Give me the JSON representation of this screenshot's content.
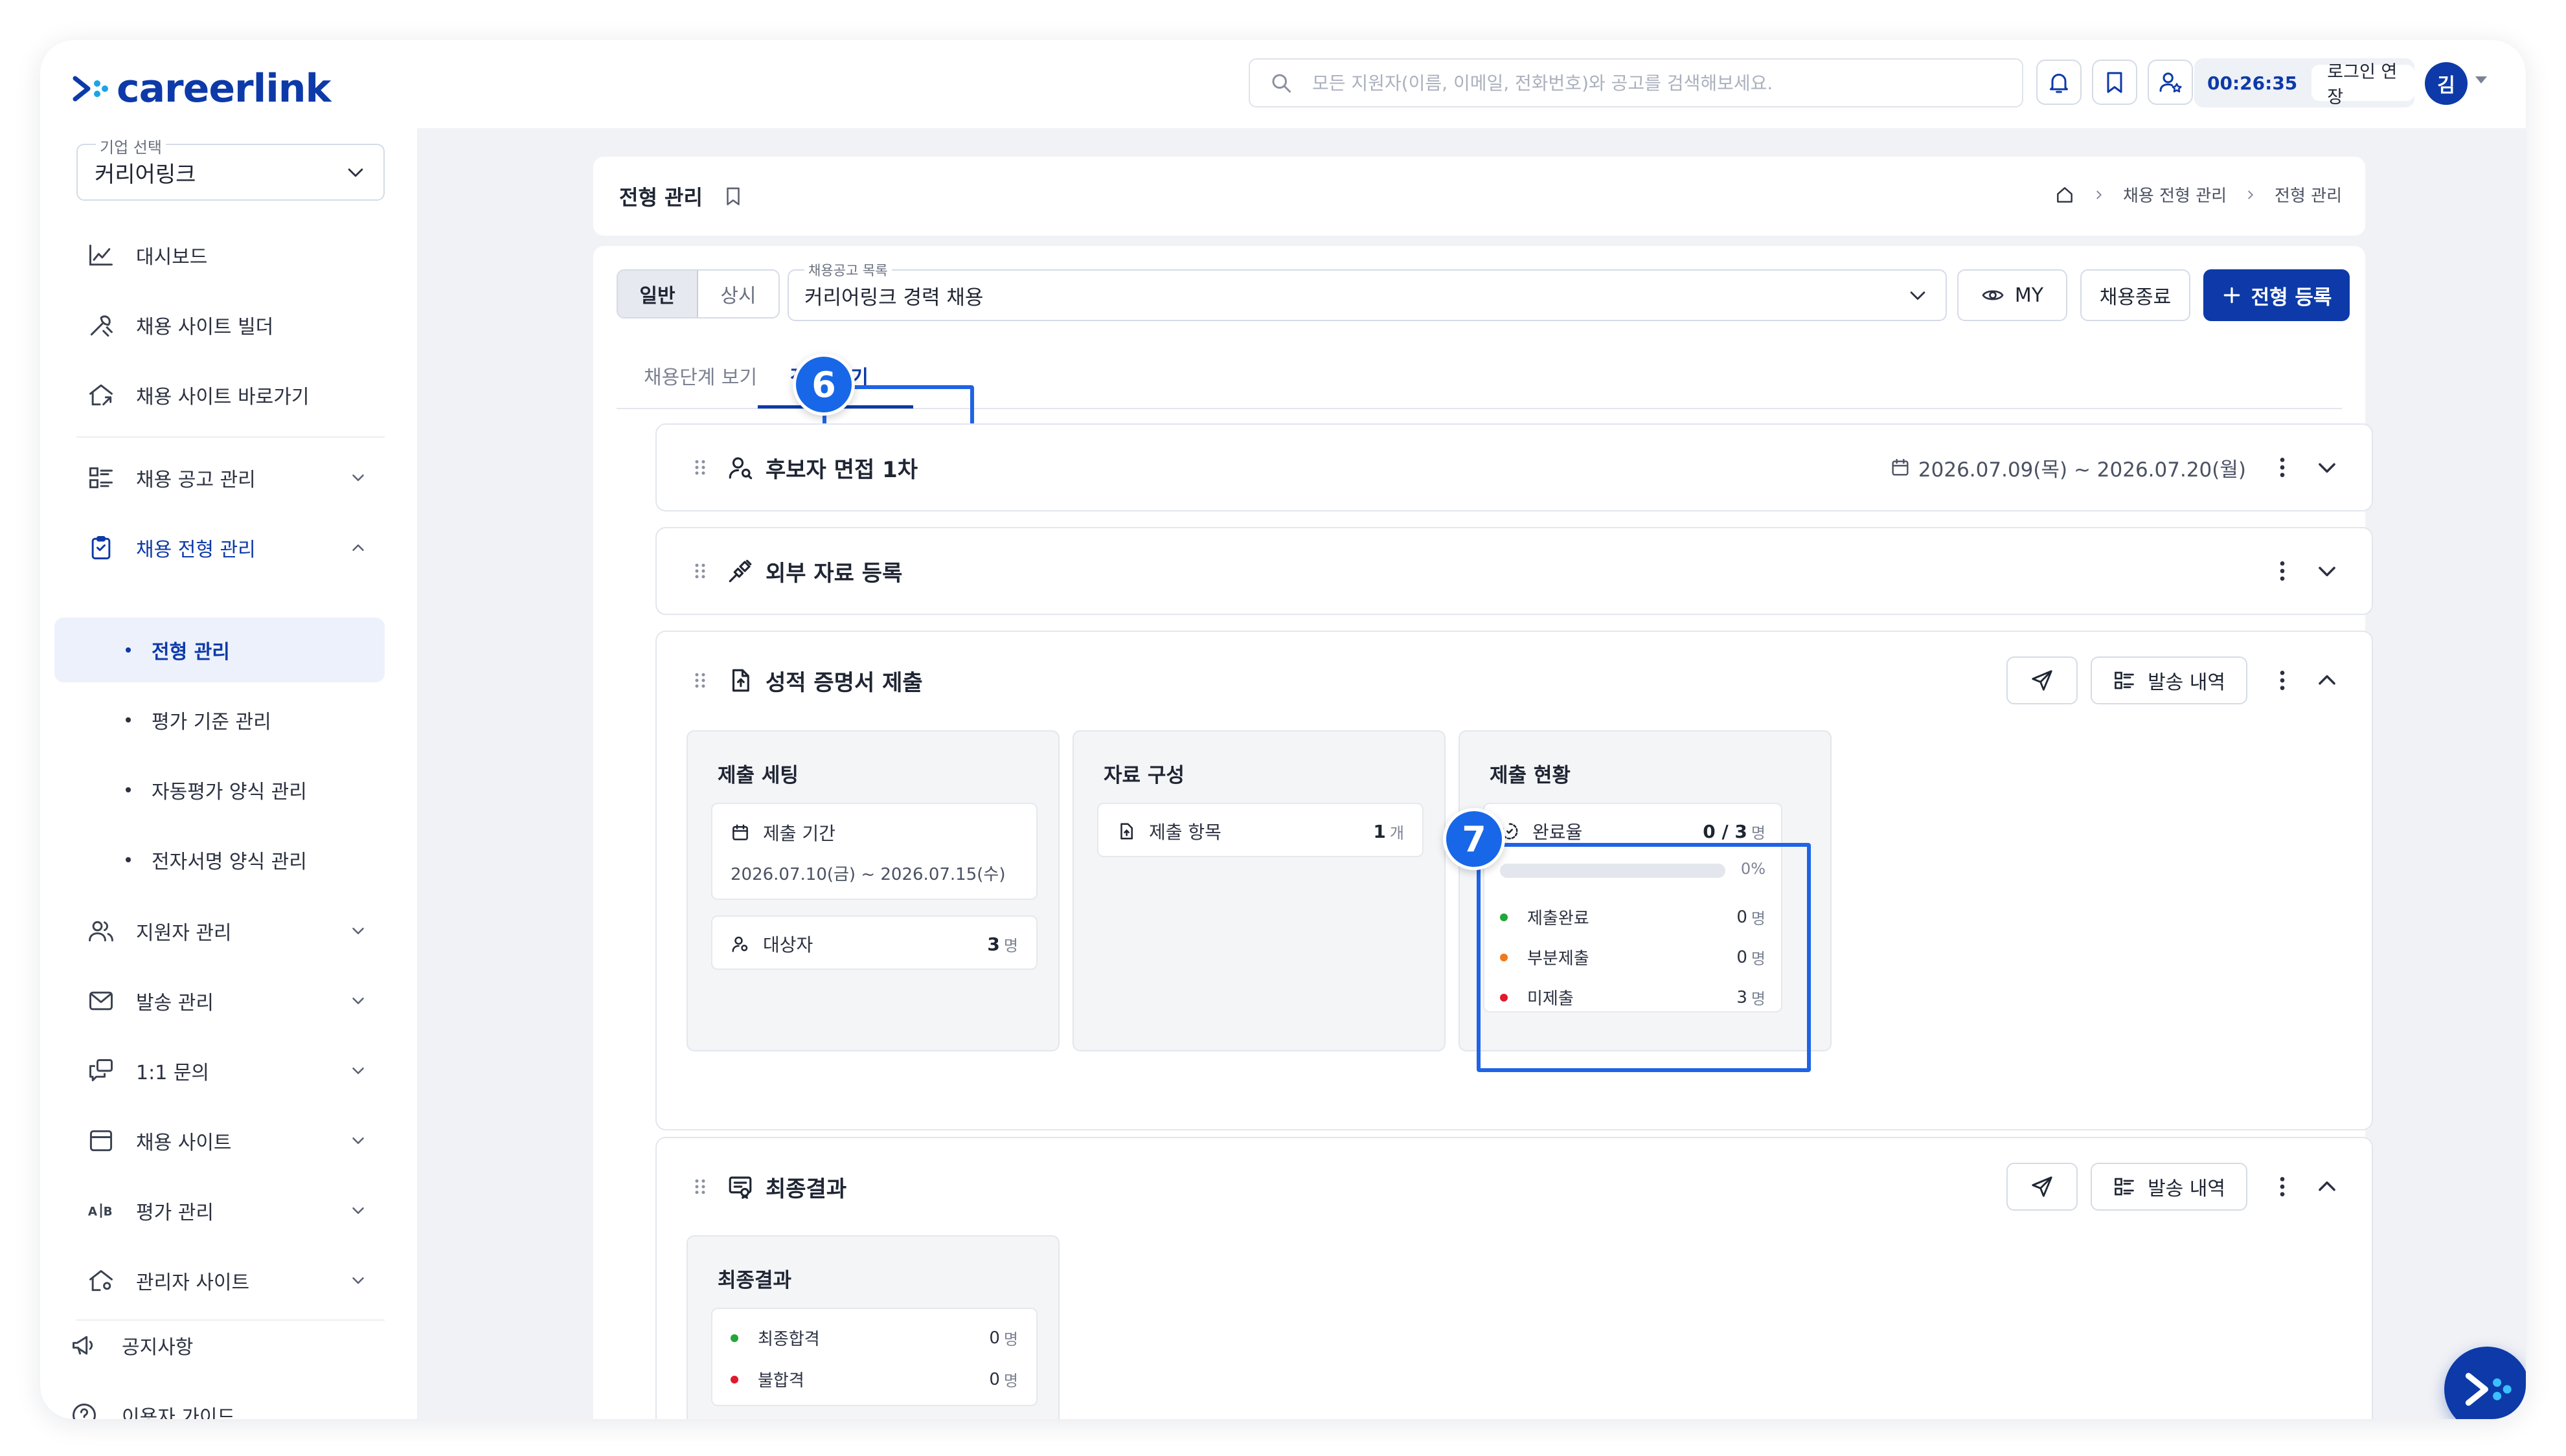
{
  "app": {
    "logo_text": "careerlink",
    "brand_color": "#0d3aa8",
    "highlight_color": "#1f63e6"
  },
  "topbar": {
    "search_placeholder": "모든 지원자(이름, 이메일, 전화번호)와 공고를 검색해보세요.",
    "icons": [
      "search-icon",
      "bell-icon",
      "bookmark-icon",
      "user-star-icon"
    ],
    "session_timer": "00:26:35",
    "extend_login_label": "로그인 연장",
    "avatar_initial": "김"
  },
  "sidebar": {
    "company_label": "기업 선택",
    "company_value": "커리어링크",
    "items": [
      {
        "label": "대시보드",
        "icon": "chart-icon"
      },
      {
        "label": "채용 사이트 빌더",
        "icon": "tools-icon"
      },
      {
        "label": "채용 사이트 바로가기",
        "icon": "home-link-icon"
      },
      {
        "label": "채용 공고 관리",
        "icon": "list-icon"
      },
      {
        "label": "채용 전형 관리",
        "icon": "clipboard-icon"
      },
      {
        "label": "지원자 관리",
        "icon": "users-icon"
      },
      {
        "label": "발송 관리",
        "icon": "mail-icon"
      },
      {
        "label": "1:1 문의",
        "icon": "chat-icon"
      },
      {
        "label": "채용 사이트",
        "icon": "window-icon"
      },
      {
        "label": "평가 관리",
        "icon": "ab-icon"
      },
      {
        "label": "관리자 사이트",
        "icon": "admin-home-icon"
      }
    ],
    "sub_items": [
      "전형 관리",
      "평가 기준 관리",
      "자동평가 양식 관리",
      "전자서명 양식 관리"
    ],
    "bottom_items": [
      {
        "label": "공지사항",
        "icon": "megaphone-icon"
      },
      {
        "label": "이용자 가이드",
        "icon": "help-icon"
      }
    ]
  },
  "page": {
    "title": "전형 관리",
    "breadcrumb": [
      "채용 전형 관리",
      "전형 관리"
    ]
  },
  "toolbar": {
    "segments": [
      "일반",
      "상시"
    ],
    "post_label": "채용공고 목록",
    "post_value": "커리어링크 경력 채용",
    "my_label": "MY",
    "close_label": "채용종료",
    "register_label": "전형 등록"
  },
  "tabs": [
    "채용단계 보기",
    "전형 보기"
  ],
  "badges": [
    "6",
    "7"
  ],
  "stages": [
    {
      "title": "후보자 면접 1차",
      "icon": "user-search-icon",
      "date": "2026.07.09(목) ~ 2026.07.20(월)",
      "expanded": false
    },
    {
      "title": "외부 자료 등록",
      "icon": "link-icon",
      "expanded": false
    },
    {
      "title": "성적 증명서 제출",
      "icon": "document-upload-icon",
      "expanded": true,
      "history_label": "발송 내역"
    },
    {
      "title": "최종결과",
      "icon": "result-icon",
      "expanded": true,
      "history_label": "발송 내역"
    }
  ],
  "submission": {
    "setting_title": "제출 세팅",
    "period_label": "제출 기간",
    "period_value": "2026.07.10(금) ~ 2026.07.15(수)",
    "target_label": "대상자",
    "target_count": "3",
    "unit_people": "명",
    "material_title": "자료 구성",
    "items_label": "제출 항목",
    "items_count": "1",
    "unit_count": "개",
    "status_title": "제출 현황",
    "completion_label": "완료율",
    "completion_value": "0 / 3",
    "completion_percent_text": "0%",
    "completion_fraction": 0,
    "statuses": [
      {
        "label": "제출완료",
        "count": "0",
        "color": "#22a63a"
      },
      {
        "label": "부분제출",
        "count": "0",
        "color": "#f07a1a"
      },
      {
        "label": "미제출",
        "count": "3",
        "color": "#e0192d"
      }
    ]
  },
  "final": {
    "panel_title": "최종결과",
    "rows": [
      {
        "label": "최종합격",
        "count": "0",
        "color": "#22a63a"
      },
      {
        "label": "불합격",
        "count": "0",
        "color": "#e0192d"
      }
    ]
  }
}
